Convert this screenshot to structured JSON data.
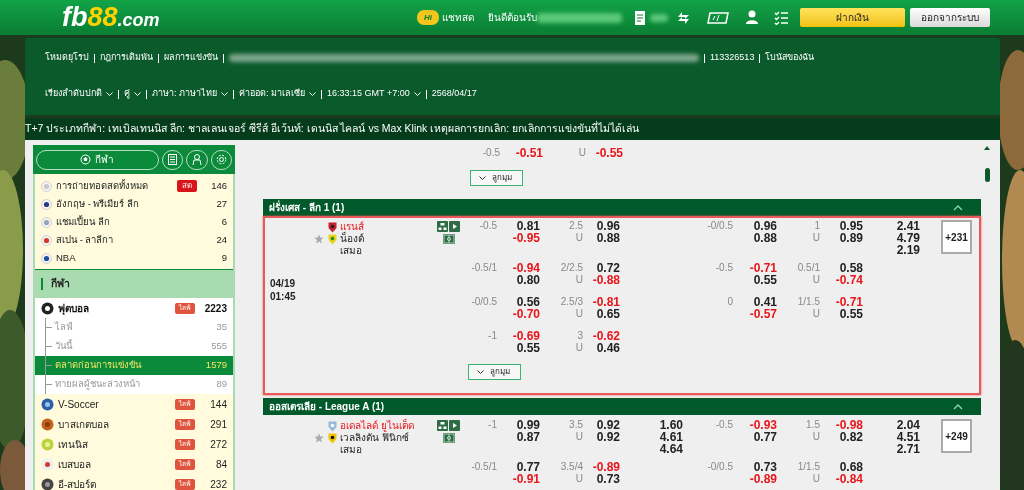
{
  "header": {
    "logo": [
      "fb",
      "88",
      ".com"
    ],
    "chat_badge": "Hi",
    "chat": "แชทสด",
    "welcome": "ยินดีต้อนรับ",
    "buttons": [
      {
        "kind": "deposit",
        "label": "ฝากเงิน"
      },
      {
        "kind": "logout",
        "label": "ออกจากระบบ"
      }
    ]
  },
  "nav": {
    "links": [
      {
        "kind": "link",
        "label": "โหมดยุโรป"
      },
      {
        "kind": "link",
        "label": "กฎการเดิมพัน"
      },
      {
        "kind": "link",
        "label": "ผลการแข่งขัน"
      },
      {
        "kind": "redacted"
      },
      {
        "kind": "link",
        "label": "113326513"
      },
      {
        "kind": "link",
        "label": "โบนัสของฉัน"
      }
    ],
    "settings": [
      {
        "label": "เรียงลำดับปกติ",
        "dropdown": true
      },
      {
        "label": "คู่",
        "dropdown": true
      },
      {
        "label": "ภาษา: ภาษาไทย",
        "dropdown": true
      },
      {
        "label": "ค่าออด: มาเลเซีย",
        "dropdown": true
      },
      {
        "label": "16:33:15 GMT +7:00",
        "dropdown": true
      },
      {
        "label": "2568/04/17",
        "dropdown": false
      }
    ]
  },
  "ticker": "T+7 ประเภทกีฬา: เทเบิลเทนนิส ลีก: ชาลเลนเจอร์ ซีรีส์ อีเว้นท์: เดนนิส ไคลน์ vs Max Klink เหตุผลการยกเลิก: ยกเลิกการแข่งขันที่ไม่ได้เล่น",
  "sidebar": {
    "tab": "กีฬา",
    "favorites": [
      {
        "name": "การถ่ายทอดสดทั้งหมด",
        "badge": "สด",
        "count": "146"
      },
      {
        "name": "อังกฤษ - พรีเมียร์ ลีก",
        "count": "27"
      },
      {
        "name": "แชมเปี้ยน ลีก",
        "count": "6"
      },
      {
        "name": "สเปน - ลาลีกา",
        "count": "24"
      },
      {
        "name": "NBA",
        "count": "9"
      }
    ],
    "section_title": "กีฬา",
    "sports": [
      {
        "name": "ฟุตบอล",
        "badge": "ไลฟ์",
        "count": "2223",
        "expanded": true,
        "children": [
          {
            "name": "ไลฟ์",
            "count": "35",
            "selected": false
          },
          {
            "name": "วันนี้",
            "count": "555",
            "selected": false
          },
          {
            "name": "ตลาดก่อนการแข่งขัน",
            "count": "1579",
            "selected": true
          },
          {
            "name": "ทายผลผู้ชนะล่วงหน้า",
            "count": "89",
            "selected": false
          }
        ]
      },
      {
        "name": "V-Soccer",
        "badge": "ไลฟ์",
        "count": "144",
        "expanded": false
      },
      {
        "name": "บาสเกตบอล",
        "badge": "ไลฟ์",
        "count": "291",
        "expanded": false
      },
      {
        "name": "เทนนิส",
        "badge": "ไลฟ์",
        "count": "272",
        "expanded": false
      },
      {
        "name": "เบสบอล",
        "badge": "ไลฟ์",
        "count": "84",
        "expanded": false
      },
      {
        "name": "อี-สปอร์ต",
        "badge": "ไลฟ์",
        "count": "232",
        "expanded": false
      }
    ]
  },
  "markets": {
    "partial": {
      "line": {
        "hdp": "-0.5",
        "hdp_odds": [
          "-0.51"
        ],
        "ou_side": "U",
        "ou_odds": [
          "-0.55"
        ]
      },
      "corner_button": "ลูกมุม"
    },
    "leagues": [
      {
        "title": "ฝรั่งเศส - ลีก 1 (1)",
        "expanded": true,
        "matches": [
          {
            "date": "04/19",
            "time": "01:45",
            "home": "แรนส์",
            "away": "น็องต์",
            "draw": "เสมอ",
            "home_favored": true,
            "highlighted": true,
            "more": "+231",
            "corner_button": "ลูกมุม",
            "lines": [
              {
                "hdp": "-0.5",
                "hdp_odds": [
                  "0.81",
                  "-0.95"
                ],
                "ou": "2.5",
                "ou_side": "U",
                "ou_odds": [
                  "0.96",
                  "0.88"
                ],
                "h_hdp": "-0/0.5",
                "h_hdp_odds": [
                  "0.96",
                  "0.88"
                ],
                "h_ou": "1",
                "h_ou_side": "U",
                "h_ou_odds": [
                  "0.95",
                  "0.89"
                ],
                "h_x12": [
                  "2.41",
                  "4.79",
                  "2.19"
                ]
              },
              {
                "hdp": "-0.5/1",
                "hdp_odds": [
                  "-0.94",
                  "0.80"
                ],
                "ou": "2/2.5",
                "ou_side": "U",
                "ou_odds": [
                  "0.72",
                  "-0.88"
                ],
                "h_hdp": "-0.5",
                "h_hdp_odds": [
                  "-0.71",
                  "0.55"
                ],
                "h_ou": "0.5/1",
                "h_ou_side": "U",
                "h_ou_odds": [
                  "0.58",
                  "-0.74"
                ]
              },
              {
                "hdp": "-0/0.5",
                "hdp_odds": [
                  "0.56",
                  "-0.70"
                ],
                "ou": "2.5/3",
                "ou_side": "U",
                "ou_odds": [
                  "-0.81",
                  "0.65"
                ],
                "h_hdp": "0",
                "h_hdp_odds": [
                  "0.41",
                  "-0.57"
                ],
                "h_ou": "1/1.5",
                "h_ou_side": "U",
                "h_ou_odds": [
                  "-0.71",
                  "0.55"
                ]
              },
              {
                "hdp": "-1",
                "hdp_odds": [
                  "-0.69",
                  "0.55"
                ],
                "ou": "3",
                "ou_side": "U",
                "ou_odds": [
                  "-0.62",
                  "0.46"
                ]
              }
            ]
          }
        ]
      },
      {
        "title": "ออสเตรเลีย - League A (1)",
        "expanded": true,
        "matches": [
          {
            "home": "อเดลไลด์ ยูไนเต็ด",
            "away": "เวลลิงตัน ฟินิกซ์",
            "draw": "เสมอ",
            "home_favored": true,
            "highlighted": false,
            "more": "+249",
            "lines": [
              {
                "hdp": "-1",
                "hdp_odds": [
                  "0.99",
                  "0.87"
                ],
                "ou": "3.5",
                "ou_side": "U",
                "ou_odds": [
                  "0.92",
                  "0.92"
                ],
                "x12": [
                  "1.60",
                  "4.61",
                  "4.64"
                ],
                "h_hdp": "-0.5",
                "h_hdp_odds": [
                  "-0.93",
                  "0.77"
                ],
                "h_ou": "1.5",
                "h_ou_side": "U",
                "h_ou_odds": [
                  "-0.98",
                  "0.82"
                ],
                "h_x12": [
                  "2.04",
                  "4.51",
                  "2.71"
                ]
              },
              {
                "hdp": "-0.5/1",
                "hdp_odds": [
                  "0.77",
                  "-0.91"
                ],
                "ou": "3.5/4",
                "ou_side": "U",
                "ou_odds": [
                  "-0.89",
                  "0.73"
                ],
                "h_hdp": "-0/0.5",
                "h_hdp_odds": [
                  "0.73",
                  "-0.89"
                ],
                "h_ou": "1/1.5",
                "h_ou_side": "U",
                "h_ou_odds": [
                  "0.68",
                  "-0.84"
                ]
              }
            ]
          }
        ]
      }
    ]
  }
}
